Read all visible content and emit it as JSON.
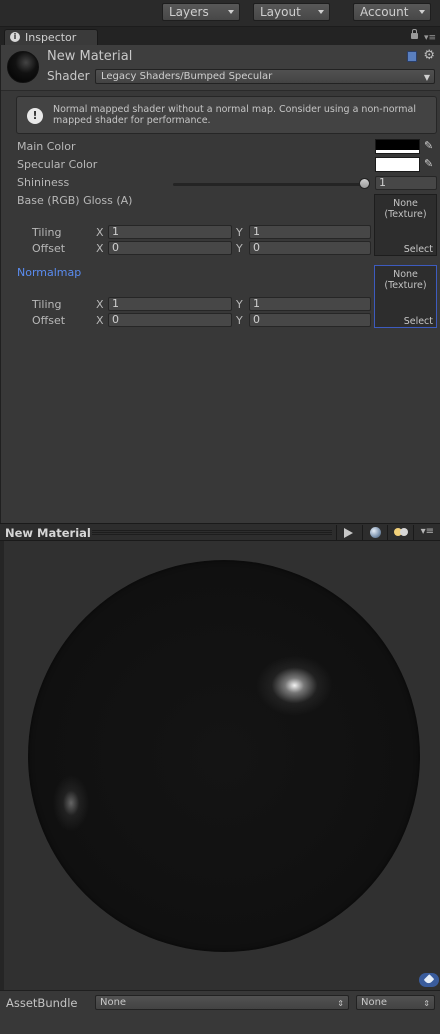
{
  "toolbar": {
    "layers_label": "Layers",
    "layout_label": "Layout",
    "account_label": "Account"
  },
  "tab": {
    "title": "Inspector"
  },
  "material": {
    "name": "New Material",
    "shader_label": "Shader",
    "shader_value": "Legacy Shaders/Bumped Specular"
  },
  "help": {
    "text": "Normal mapped shader without a normal map. Consider using a non-normal mapped shader for performance."
  },
  "properties": {
    "main_color_label": "Main Color",
    "main_color": "#000000",
    "specular_color_label": "Specular Color",
    "specular_color": "#ffffff",
    "shininess_label": "Shininess",
    "shininess_value": "1",
    "base_label": "Base (RGB) Gloss (A)",
    "base_tiling_label": "Tiling",
    "base_tiling_x": "1",
    "base_tiling_y": "1",
    "base_offset_label": "Offset",
    "base_offset_x": "0",
    "base_offset_y": "0",
    "normal_label": "Normalmap",
    "normal_tiling_label": "Tiling",
    "normal_tiling_x": "1",
    "normal_tiling_y": "1",
    "normal_offset_label": "Offset",
    "normal_offset_x": "0",
    "normal_offset_y": "0",
    "axis_x": "X",
    "axis_y": "Y",
    "texture_none": "None\n(Texture)",
    "select_label": "Select"
  },
  "preview": {
    "title": "New Material"
  },
  "bundle": {
    "label": "AssetBundle",
    "name_value": "None",
    "variant_value": "None"
  },
  "colors": {
    "accent_link": "#5a8cf0",
    "selected_border": "#3d5bbf"
  }
}
